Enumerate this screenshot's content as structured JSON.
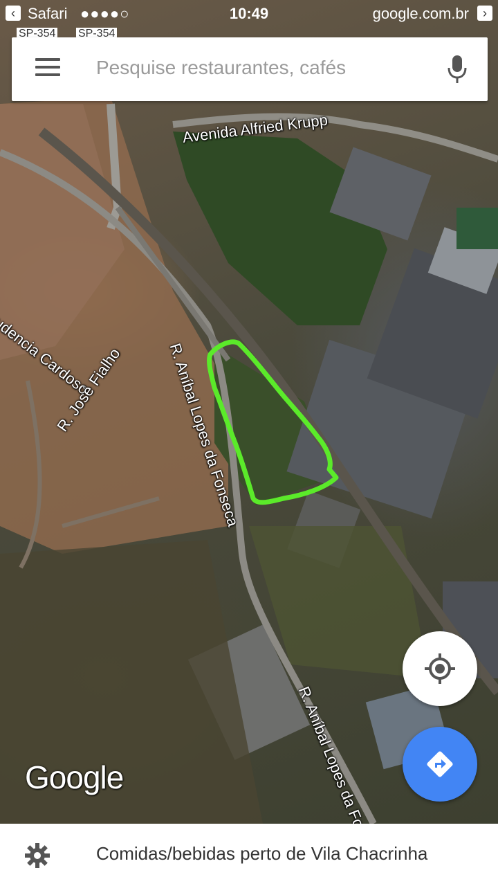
{
  "status_bar": {
    "carrier": "Safari",
    "signal": "●●●●○",
    "time": "10:49",
    "url": "google.com.br"
  },
  "search": {
    "placeholder": "Pesquise restaurantes, cafés"
  },
  "map": {
    "labels": [
      "Avenida Alfried Krupp",
      "udencia Cardoso",
      "R. José Fialho",
      "R. Aníbal Lopes da Fonseca",
      "R. Aníbal Lopes da Fo",
      "SP-354",
      "SP-354"
    ],
    "logo": "Google",
    "highlight_color": "#5bea2a"
  },
  "bottom_bar": {
    "text": "Comidas/bebidas perto de Vila Chacrinha"
  },
  "colors": {
    "directions": "#4285f4"
  }
}
